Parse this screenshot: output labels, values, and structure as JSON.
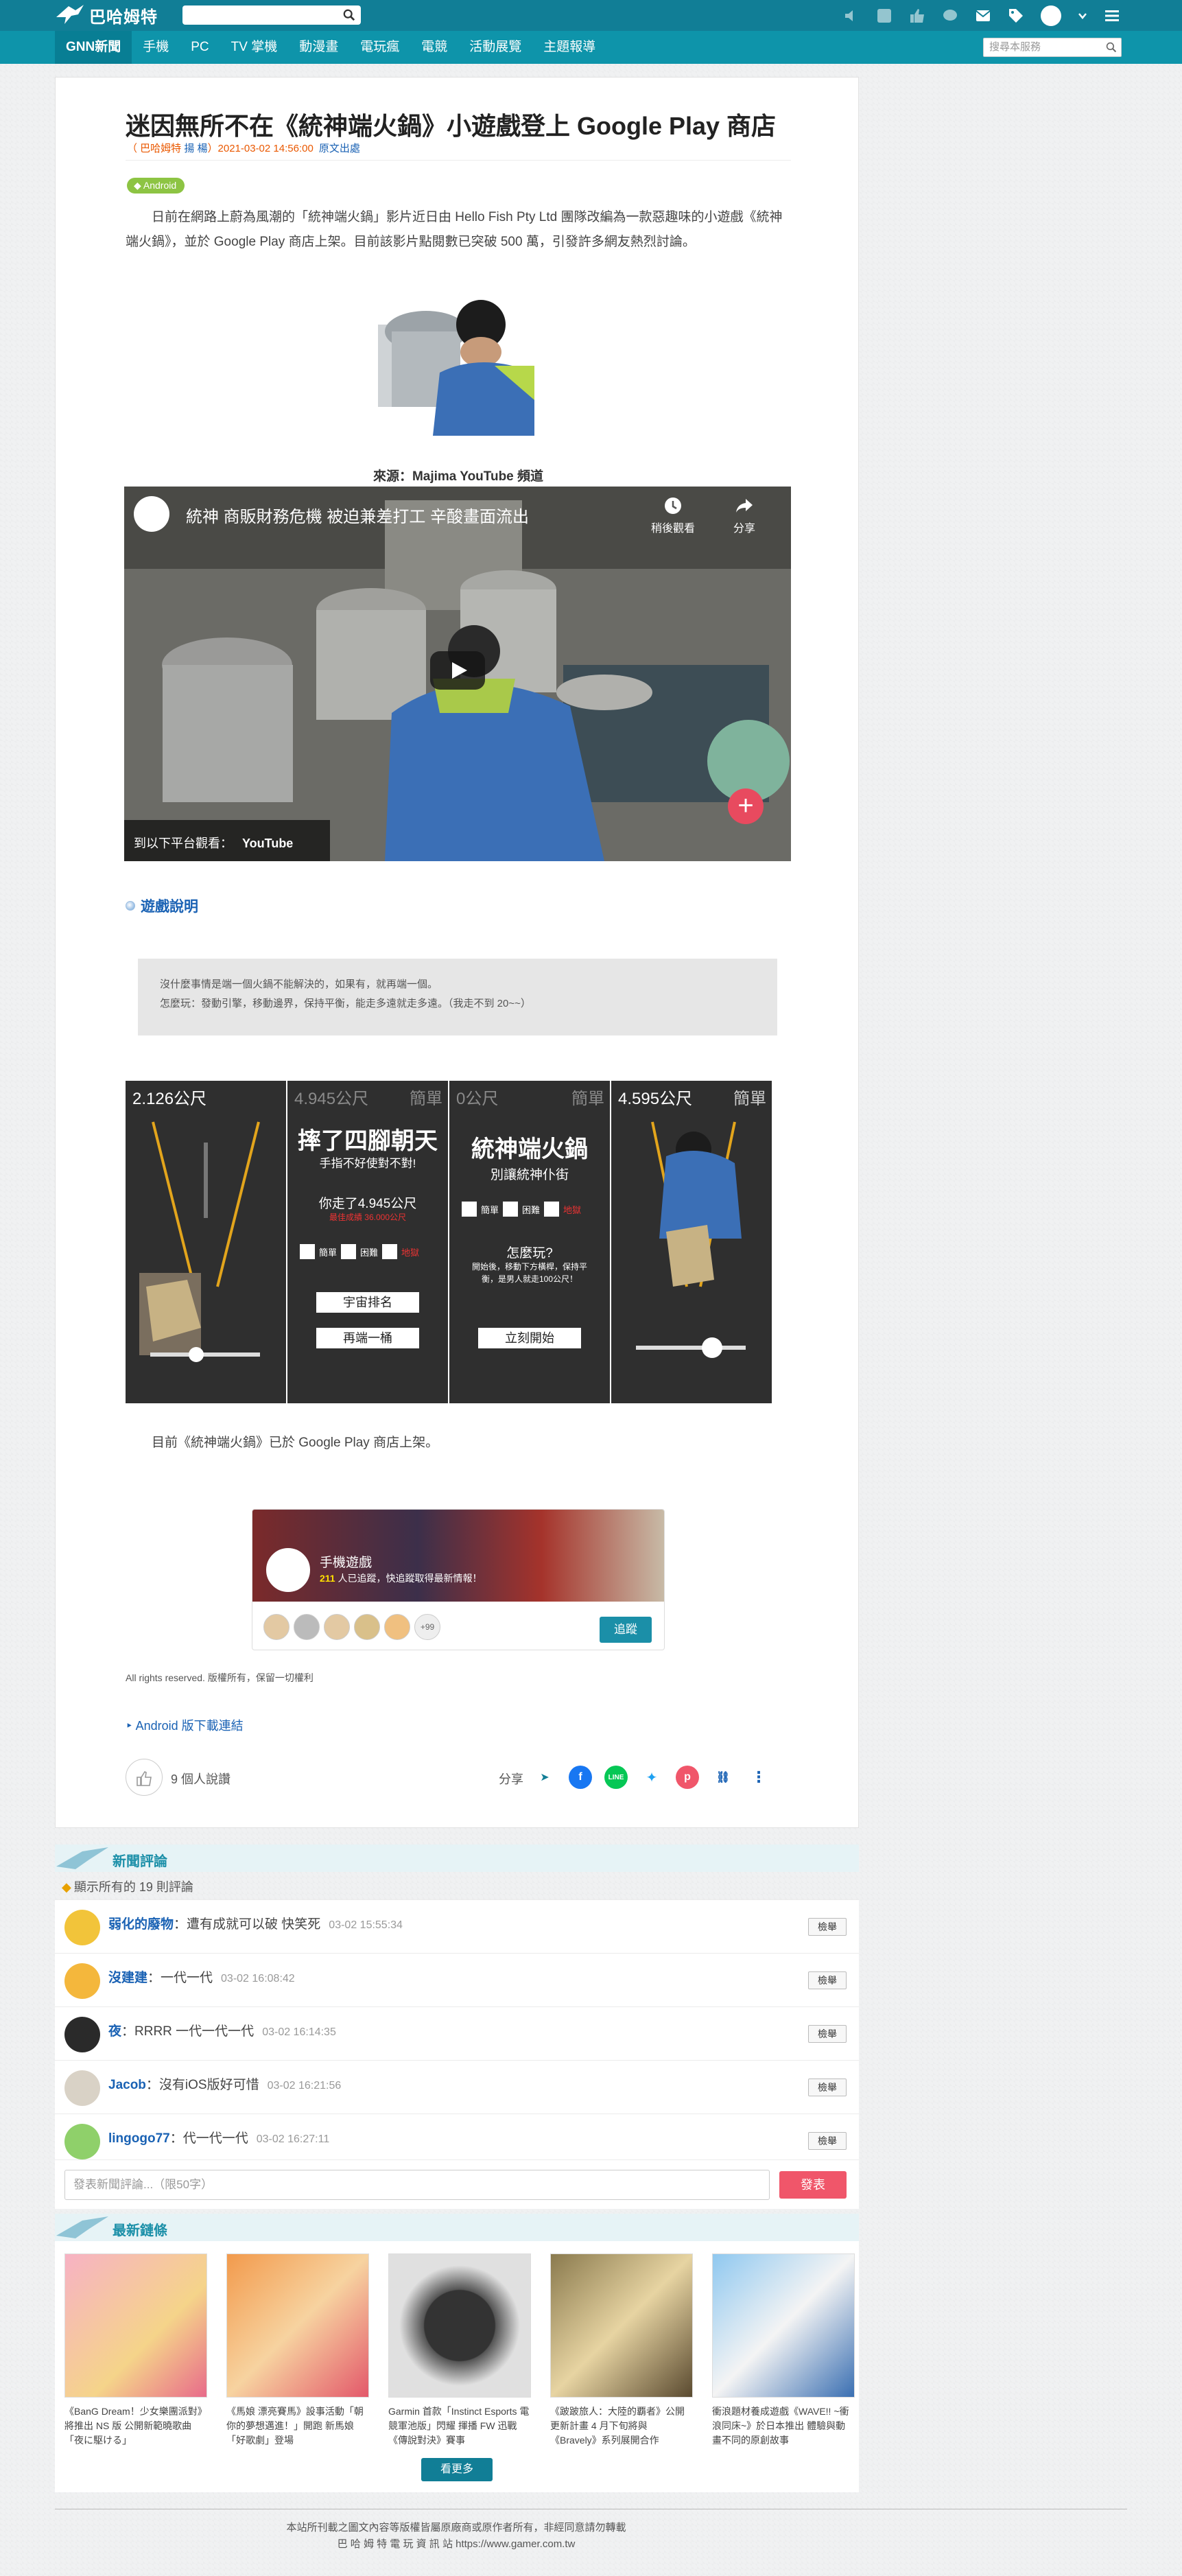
{
  "header": {
    "logo_text": "巴哈姆特",
    "nav": [
      "GNN新聞",
      "手機",
      "PC",
      "TV 掌機",
      "動漫畫",
      "電玩瘋",
      "電競",
      "活動展覽",
      "主題報導"
    ],
    "nav_search_placeholder": "搜尋本服務"
  },
  "article": {
    "title": "迷因無所不在《統神端火鍋》小遊戲登上 Google Play 商店",
    "meta_prefix": "（ 巴哈姆特 ",
    "meta_author": "揚 楊",
    "meta_date": "）2021-03-02 14:56:00",
    "source_link": "原文出處",
    "tag": "Android",
    "para1": "日前在網路上蔚為風潮的「統神端火鍋」影片近日由 Hello Fish Pty Ltd 團隊改編為一款惡趣味的小遊戲《統神端火鍋》，並於 Google Play 商店上架。目前該影片點閱數已突破 500 萬，引發許多網友熱烈討論。",
    "caption": "來源：Majima YouTube 頻道",
    "video": {
      "title": "統神 商販財務危機 被迫兼差打工 辛酸畫面流出",
      "watch_later": "稍後觀看",
      "share": "分享",
      "watch_on": "到以下平台觀看：",
      "yt": "YouTube"
    },
    "section_heading": "遊戲說明",
    "quote_line1": "沒什麼事情是端一個火鍋不能解決的，如果有，就再端一個。",
    "quote_line2": "怎麼玩：發動引擎，移動邊界，保持平衡，能走多遠就走多遠。（我走不到 20~~）",
    "screens": {
      "s1_dist": "2.126公尺",
      "s2_dist": "4.945公尺",
      "s2_diff": "簡單",
      "s2_big": "摔了四腳朝天",
      "s2_sub": "手指不好使對不對!",
      "s2_walked": "你走了4.945公尺",
      "s2_record": "最佳成績 36.000公尺",
      "opt_easy": "簡單",
      "opt_hard": "困難",
      "opt_hell": "地獄",
      "s2_btn1": "宇宙排名",
      "s2_btn2": "再端一桶",
      "s3_dist": "0公尺",
      "s3_diff": "簡單",
      "s3_big": "統神端火鍋",
      "s3_sub": "別讓統神仆街",
      "s3_how": "怎麼玩?",
      "s3_desc1": "開始後，移動下方橫桿，保持平",
      "s3_desc2": "衡，是男人就走100公尺！",
      "s3_btn": "立刻開始",
      "s4_dist": "4.595公尺",
      "s4_diff": "簡單"
    },
    "para2": "目前《統神端火鍋》已於 Google Play 商店上架。",
    "follow": {
      "app_name": "手機遊戲",
      "followers": "211",
      "desc": " 人已追蹤，快追蹤取得最新情報！",
      "more": "+99",
      "button": "追蹤"
    },
    "rights": "All rights reserved. 版權所有，保留一切權利",
    "download": "Android 版下載連結",
    "likes": "9 個人說讚",
    "share_label": "分享"
  },
  "comments": {
    "header": "新聞評論",
    "all": "顯示所有的 19 則評論",
    "report": "檢舉",
    "items": [
      {
        "name": "弱化的廢物",
        "text": "：遭有成就可以破 快笑死",
        "time": "03-02 15:55:34"
      },
      {
        "name": "沒建建",
        "text": "：一代一代",
        "time": "03-02 16:08:42"
      },
      {
        "name": "夜",
        "text": "：RRRR 一代一代一代",
        "time": "03-02 16:14:35"
      },
      {
        "name": "Jacob",
        "text": "：沒有iOS版好可惜",
        "time": "03-02 16:21:56"
      },
      {
        "name": "lingogo77",
        "text": "：代一代一代",
        "time": "03-02 16:27:11"
      }
    ],
    "input_placeholder": "發表新聞評論...（限50字）",
    "post": "發表"
  },
  "latest": {
    "header": "最新鏈條",
    "items": [
      "《BanG Dream！少女樂團派對》將推出 NS 版 公開新範曉歌曲「夜に駆ける」",
      "《馬娘 漂亮賽馬》設事活動「朝你的夢想邁進！」開跑 新馬娘「好歌劇」登場",
      "Garmin 首款「Instinct Esports 電競軍池版」閃耀 揮播 FW 迅戰《傳說對決》賽事",
      "《跛跛旅人：大陸的覇者》公開更新計畫 4 月下旬將與《Bravely》系列展開合作",
      "衝浪題材養成遊戲《WAVE!! ~衝浪同床~》於日本推出 體驗與動畫不同的原創故事"
    ],
    "more": "看更多"
  },
  "footer": {
    "line1": "本站所刊載之圖文內容等版權皆屬原廠商或原作者所有，非經同意請勿轉載",
    "line2": "巴 哈 姆 特 電 玩 資 訊 站 https://www.gamer.com.tw"
  }
}
